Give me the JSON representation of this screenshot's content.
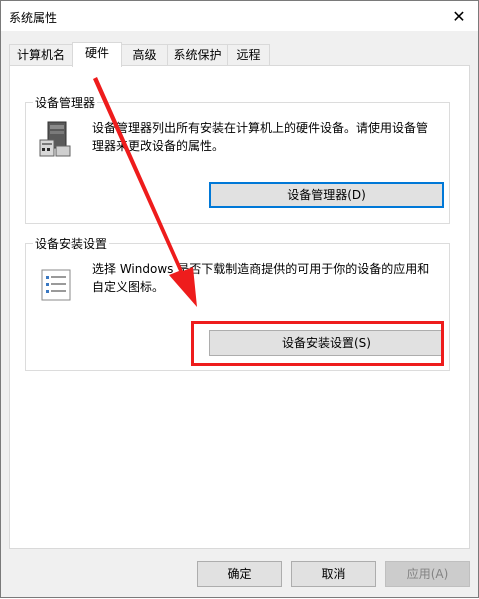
{
  "window": {
    "title": "系统属性",
    "close_glyph": "✕"
  },
  "tabs": [
    {
      "label": "计算机名",
      "active": false
    },
    {
      "label": "硬件",
      "active": true
    },
    {
      "label": "高级",
      "active": false
    },
    {
      "label": "系统保护",
      "active": false
    },
    {
      "label": "远程",
      "active": false
    }
  ],
  "device_manager": {
    "label": "设备管理器",
    "description": "设备管理器列出所有安装在计算机上的硬件设备。请使用设备管理器来更改设备的属性。",
    "button": "设备管理器(D)",
    "icon": "device-manager-icon"
  },
  "device_install": {
    "label": "设备安装设置",
    "description": "选择 Windows 是否下载制造商提供的可用于你的设备的应用和自定义图标。",
    "button": "设备安装设置(S)",
    "icon": "device-install-settings-icon"
  },
  "footer": {
    "ok": "确定",
    "cancel": "取消",
    "apply": "应用(A)"
  },
  "colors": {
    "annotation": "#ee1c1c",
    "focus": "#0078d7"
  }
}
